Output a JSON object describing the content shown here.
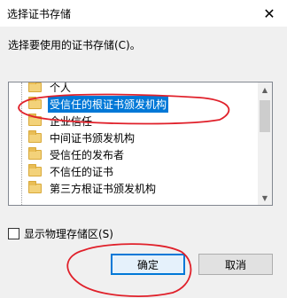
{
  "window": {
    "title": "选择证书存储",
    "close_glyph": "✕"
  },
  "prompt": "选择要使用的证书存储(C)。",
  "tree": {
    "items": [
      {
        "label": "个人",
        "selected": false
      },
      {
        "label": "受信任的根证书颁发机构",
        "selected": true
      },
      {
        "label": "企业信任",
        "selected": false
      },
      {
        "label": "中间证书颁发机构",
        "selected": false
      },
      {
        "label": "受信任的发布者",
        "selected": false
      },
      {
        "label": "不信任的证书",
        "selected": false
      },
      {
        "label": "第三方根证书颁发机构",
        "selected": false
      }
    ],
    "selection_color": "#0078d7"
  },
  "checkbox": {
    "label": "显示物理存储区(S)",
    "checked": false
  },
  "buttons": {
    "ok": "确定",
    "cancel": "取消"
  },
  "annotation_color": "#e0202a"
}
